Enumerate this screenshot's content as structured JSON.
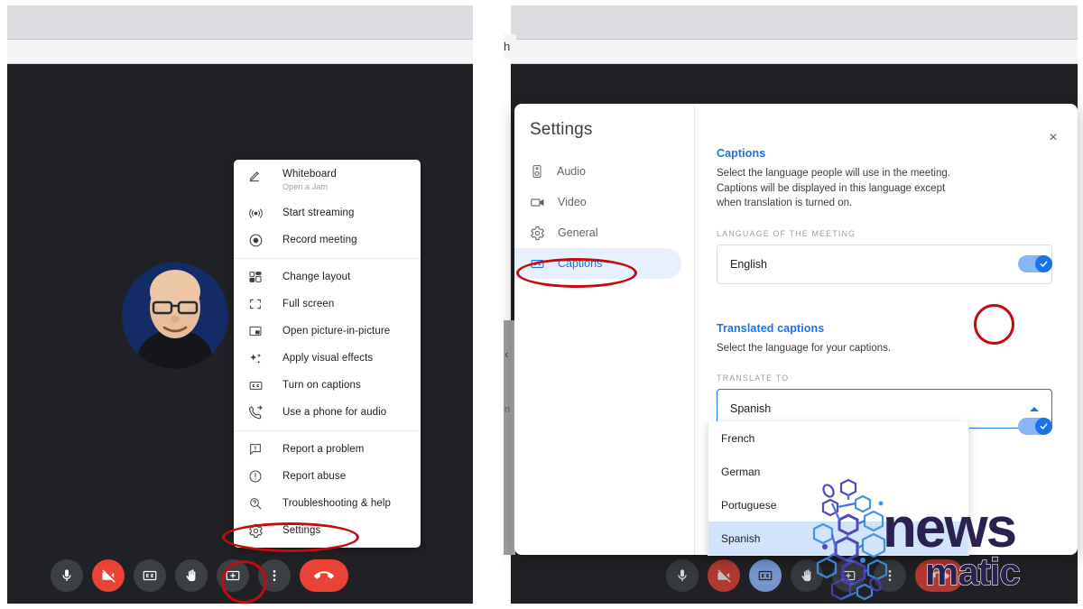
{
  "left_panel": {
    "overflow_menu": {
      "groups": [
        [
          {
            "icon": "pencil-icon",
            "label": "Whiteboard",
            "sublabel": "Open a Jam"
          },
          {
            "icon": "broadcast-icon",
            "label": "Start streaming",
            "sublabel": ""
          },
          {
            "icon": "record-icon",
            "label": "Record meeting",
            "sublabel": ""
          }
        ],
        [
          {
            "icon": "layout-icon",
            "label": "Change layout",
            "sublabel": ""
          },
          {
            "icon": "fullscreen-icon",
            "label": "Full screen",
            "sublabel": ""
          },
          {
            "icon": "pip-icon",
            "label": "Open picture-in-picture",
            "sublabel": ""
          },
          {
            "icon": "sparkle-icon",
            "label": "Apply visual effects",
            "sublabel": ""
          },
          {
            "icon": "cc-icon",
            "label": "Turn on captions",
            "sublabel": ""
          },
          {
            "icon": "phone-forward-icon",
            "label": "Use a phone for audio",
            "sublabel": ""
          }
        ],
        [
          {
            "icon": "report-problem-icon",
            "label": "Report a problem",
            "sublabel": ""
          },
          {
            "icon": "report-abuse-icon",
            "label": "Report abuse",
            "sublabel": ""
          },
          {
            "icon": "troubleshooting-icon",
            "label": "Troubleshooting & help",
            "sublabel": ""
          },
          {
            "icon": "gear-icon",
            "label": "Settings",
            "sublabel": ""
          }
        ]
      ]
    },
    "controls": [
      {
        "name": "microphone-button",
        "icon": "microphone-icon",
        "state": "on"
      },
      {
        "name": "camera-button",
        "icon": "camera-off-icon",
        "state": "off"
      },
      {
        "name": "captions-button",
        "icon": "cc-icon",
        "state": "off"
      },
      {
        "name": "raise-hand-button",
        "icon": "hand-icon",
        "state": "off"
      },
      {
        "name": "present-button",
        "icon": "present-screen-icon",
        "state": "off"
      },
      {
        "name": "more-options-button",
        "icon": "three-dots-icon",
        "state": "off"
      },
      {
        "name": "leave-call-button",
        "icon": "hangup-icon",
        "state": "on"
      }
    ]
  },
  "right_panel": {
    "tab_fragment_text": "h",
    "edge_chevron": "‹",
    "edge_letter": "n",
    "settings": {
      "title": "Settings",
      "close_label": "×",
      "sidebar": [
        {
          "icon": "speaker-icon",
          "label": "Audio",
          "active": false
        },
        {
          "icon": "video-camera-icon",
          "label": "Video",
          "active": false
        },
        {
          "icon": "gear-icon",
          "label": "General",
          "active": false
        },
        {
          "icon": "cc-icon",
          "label": "Captions",
          "active": true
        }
      ],
      "captions_section": {
        "title": "Captions",
        "description": "Select the language people will use in the meeting. Captions will be displayed in this language except when translation is turned on.",
        "field_label": "LANGUAGE OF THE MEETING",
        "selected_value": "English",
        "toggle_on": true
      },
      "translated_section": {
        "title": "Translated captions",
        "description": "Select the language for your captions.",
        "field_label": "TRANSLATE TO",
        "selected_value": "Spanish",
        "toggle_on": true,
        "dropdown_options": [
          {
            "label": "French",
            "selected": false
          },
          {
            "label": "German",
            "selected": false
          },
          {
            "label": "Portuguese",
            "selected": false
          },
          {
            "label": "Spanish",
            "selected": true
          }
        ]
      }
    },
    "controls": [
      {
        "name": "microphone-button",
        "icon": "microphone-icon",
        "state": "on"
      },
      {
        "name": "camera-button",
        "icon": "camera-off-icon",
        "state": "off"
      },
      {
        "name": "captions-button",
        "icon": "cc-icon",
        "state": "active"
      },
      {
        "name": "raise-hand-button",
        "icon": "hand-icon",
        "state": "off"
      },
      {
        "name": "present-button",
        "icon": "present-screen-icon",
        "state": "off"
      },
      {
        "name": "more-options-button",
        "icon": "three-dots-icon",
        "state": "off"
      },
      {
        "name": "leave-call-button",
        "icon": "hangup-icon",
        "state": "on"
      }
    ]
  },
  "watermark": {
    "primary_text": "news",
    "secondary_text": "matic"
  },
  "colors": {
    "accent_blue": "#1a73e8",
    "toggle_track": "#8ab4f8",
    "annotation_red": "#c10d0d",
    "meet_dark": "#202124",
    "hangup_red": "#ea4335",
    "active_nav_bg": "#e8f0fe",
    "dropdown_selected_bg": "#d2e3fc",
    "watermark_dark": "#2b2150"
  }
}
